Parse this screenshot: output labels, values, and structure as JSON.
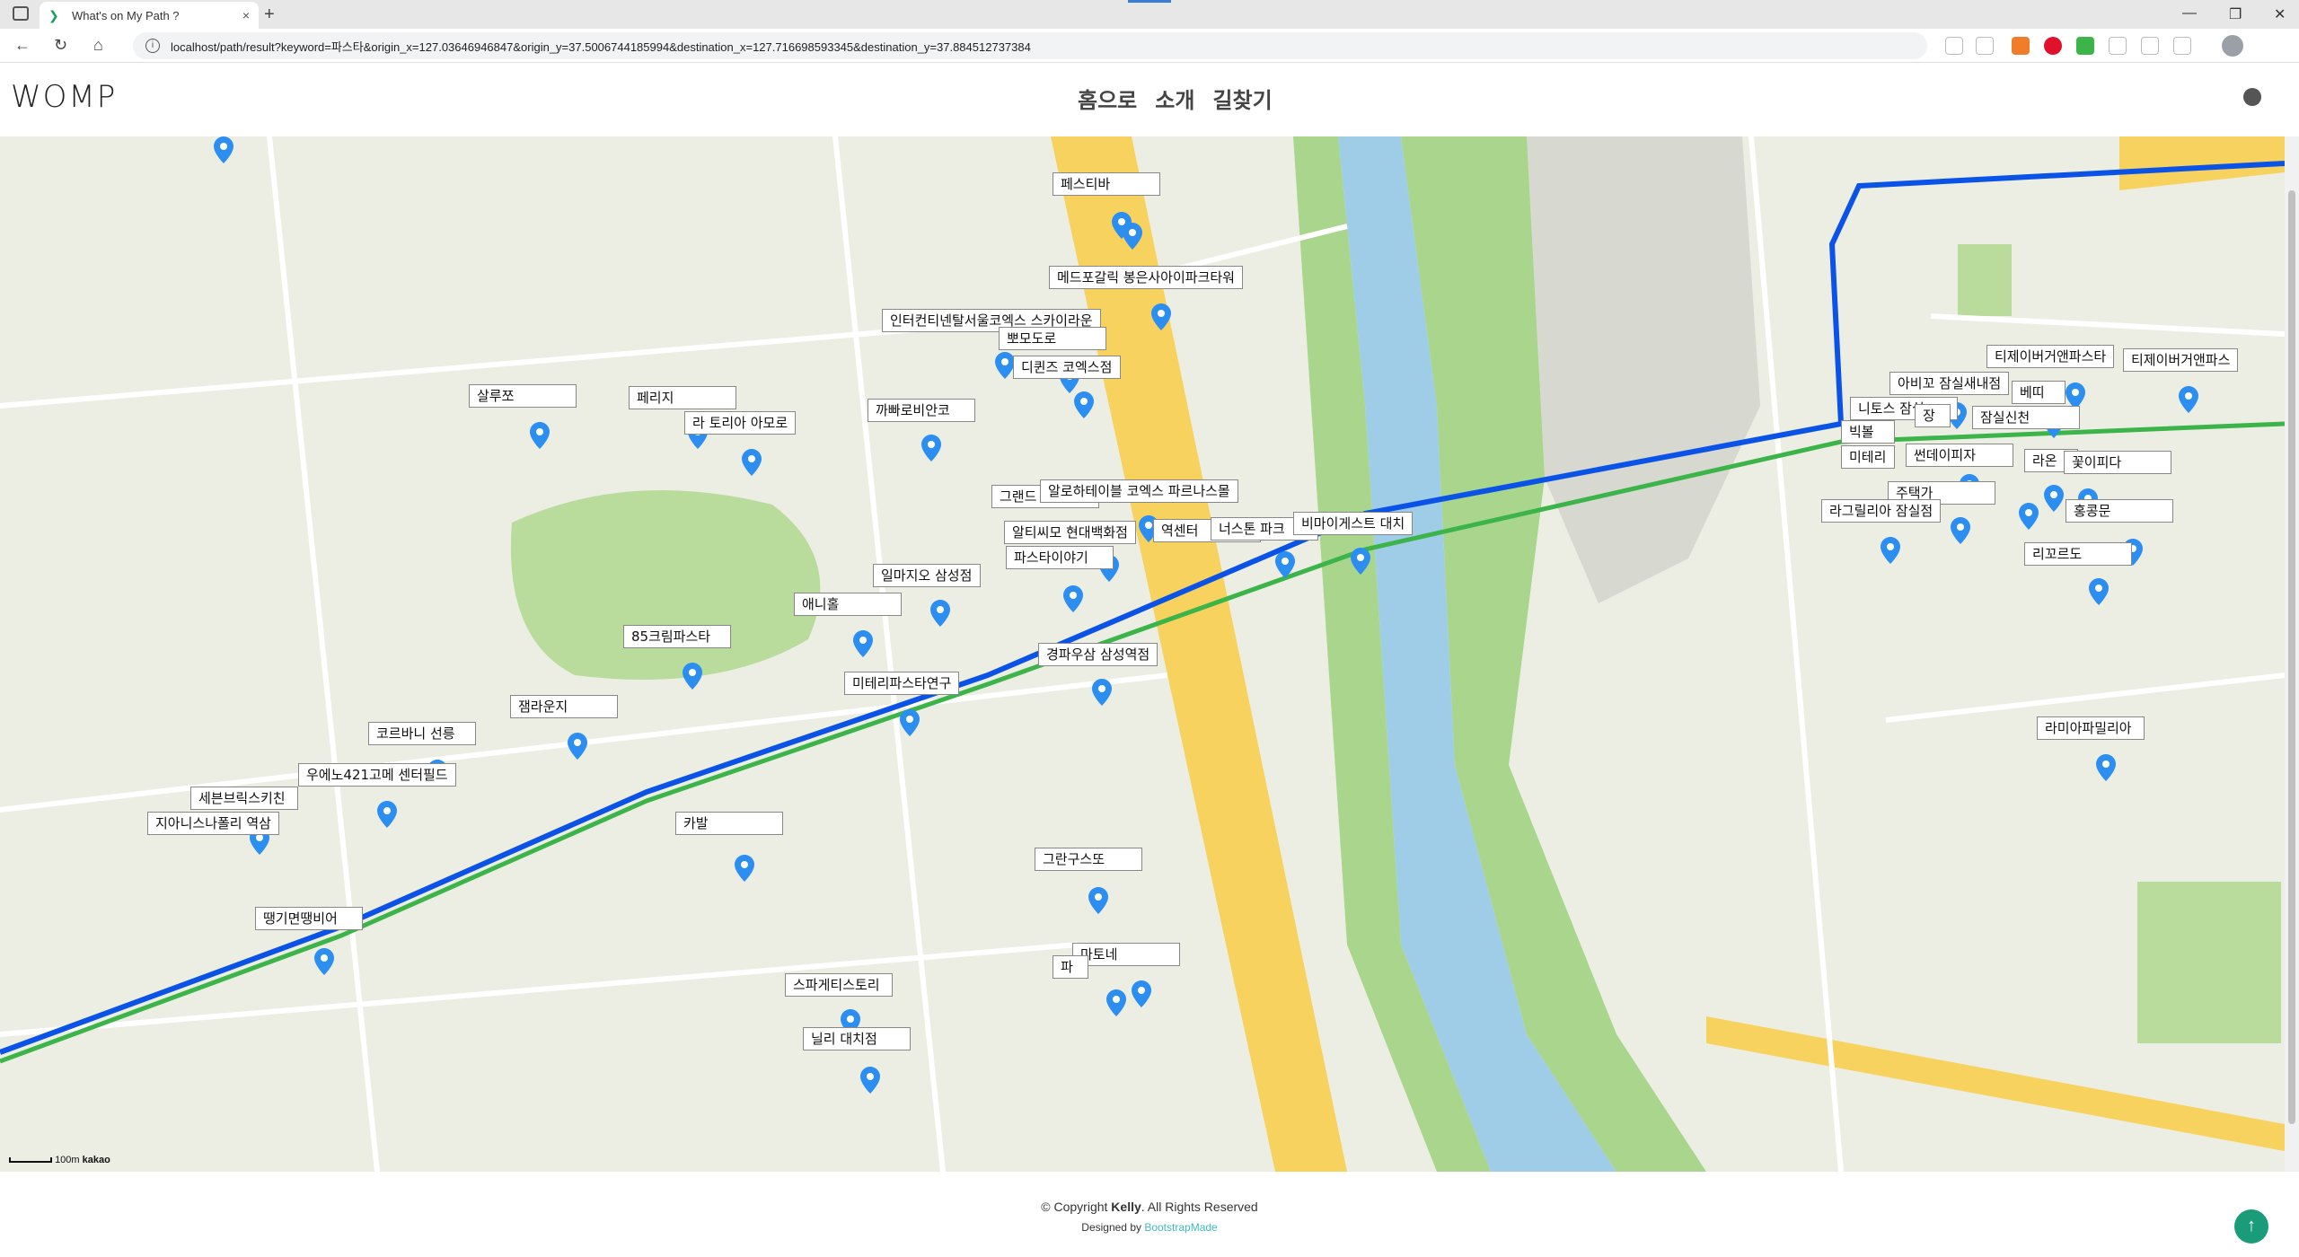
{
  "browser": {
    "tab_title": "What's on My Path ?",
    "url": "localhost/path/result?keyword=파스타&origin_x=127.03646946847&origin_y=37.5006744185994&destination_x=127.716698593345&destination_y=37.884512737384",
    "new_tab": "+",
    "tab_close": "×"
  },
  "header": {
    "logo": "WOMP",
    "nav": [
      "홈으로",
      "소개",
      "길찾기"
    ]
  },
  "map": {
    "scale_label": "100m",
    "provider": "kakao",
    "route_color": "#0b53e6",
    "subway_color": "#3cb44a",
    "places": [
      {
        "name": "페스티바"
      },
      {
        "name": "메드포갈릭 봉은사아이파크타워"
      },
      {
        "name": "인터컨티넨탈서울코엑스 스카이라운"
      },
      {
        "name": "뽀모도로"
      },
      {
        "name": "디퀸즈 코엑스점"
      },
      {
        "name": "까빠로비안코"
      },
      {
        "name": "살루쪼"
      },
      {
        "name": "페리지"
      },
      {
        "name": "라 토리아 아모로"
      },
      {
        "name": "그랜드"
      },
      {
        "name": "알로하테이블 코엑스 파르나스몰"
      },
      {
        "name": "알티씨모 현대백화점"
      },
      {
        "name": "역센터"
      },
      {
        "name": "너스톤 파크"
      },
      {
        "name": "비마이게스트 대치"
      },
      {
        "name": "파스타이야기"
      },
      {
        "name": "일마지오 삼성점"
      },
      {
        "name": "애니홀"
      },
      {
        "name": "85크림파스타"
      },
      {
        "name": "경파우삼 삼성역점"
      },
      {
        "name": "미테리파스타연구"
      },
      {
        "name": "잼라운지"
      },
      {
        "name": "코르바니 선릉"
      },
      {
        "name": "우에노421고메 센터필드"
      },
      {
        "name": "세븐브릭스키친"
      },
      {
        "name": "지아니스나폴리 역삼"
      },
      {
        "name": "카발"
      },
      {
        "name": "땡기면땡비어"
      },
      {
        "name": "그란구스또"
      },
      {
        "name": "마토네"
      },
      {
        "name": "파"
      },
      {
        "name": "스파게티스토리"
      },
      {
        "name": "닐리 대치점"
      },
      {
        "name": "티제이버거앤파스타"
      },
      {
        "name": "티제이버거앤파스"
      },
      {
        "name": "아비꼬 잠실새내점"
      },
      {
        "name": "니토스 잠실"
      },
      {
        "name": "장"
      },
      {
        "name": "베띠"
      },
      {
        "name": "잠실신천"
      },
      {
        "name": "빅볼"
      },
      {
        "name": "미테리"
      },
      {
        "name": "썬데이피자"
      },
      {
        "name": "라온"
      },
      {
        "name": "꽃이피다"
      },
      {
        "name": "주택가"
      },
      {
        "name": "라그릴리아 잠실점"
      },
      {
        "name": "홍콩문"
      },
      {
        "name": "리꼬르도"
      },
      {
        "name": "라미아파밀리아"
      }
    ]
  },
  "footer": {
    "copyright_prefix": "© Copyright ",
    "copyright_name": "Kelly",
    "copyright_suffix": ". All Rights Reserved",
    "designed_prefix": "Designed by ",
    "designed_link": "BootstrapMade",
    "back_to_top": "↑"
  }
}
